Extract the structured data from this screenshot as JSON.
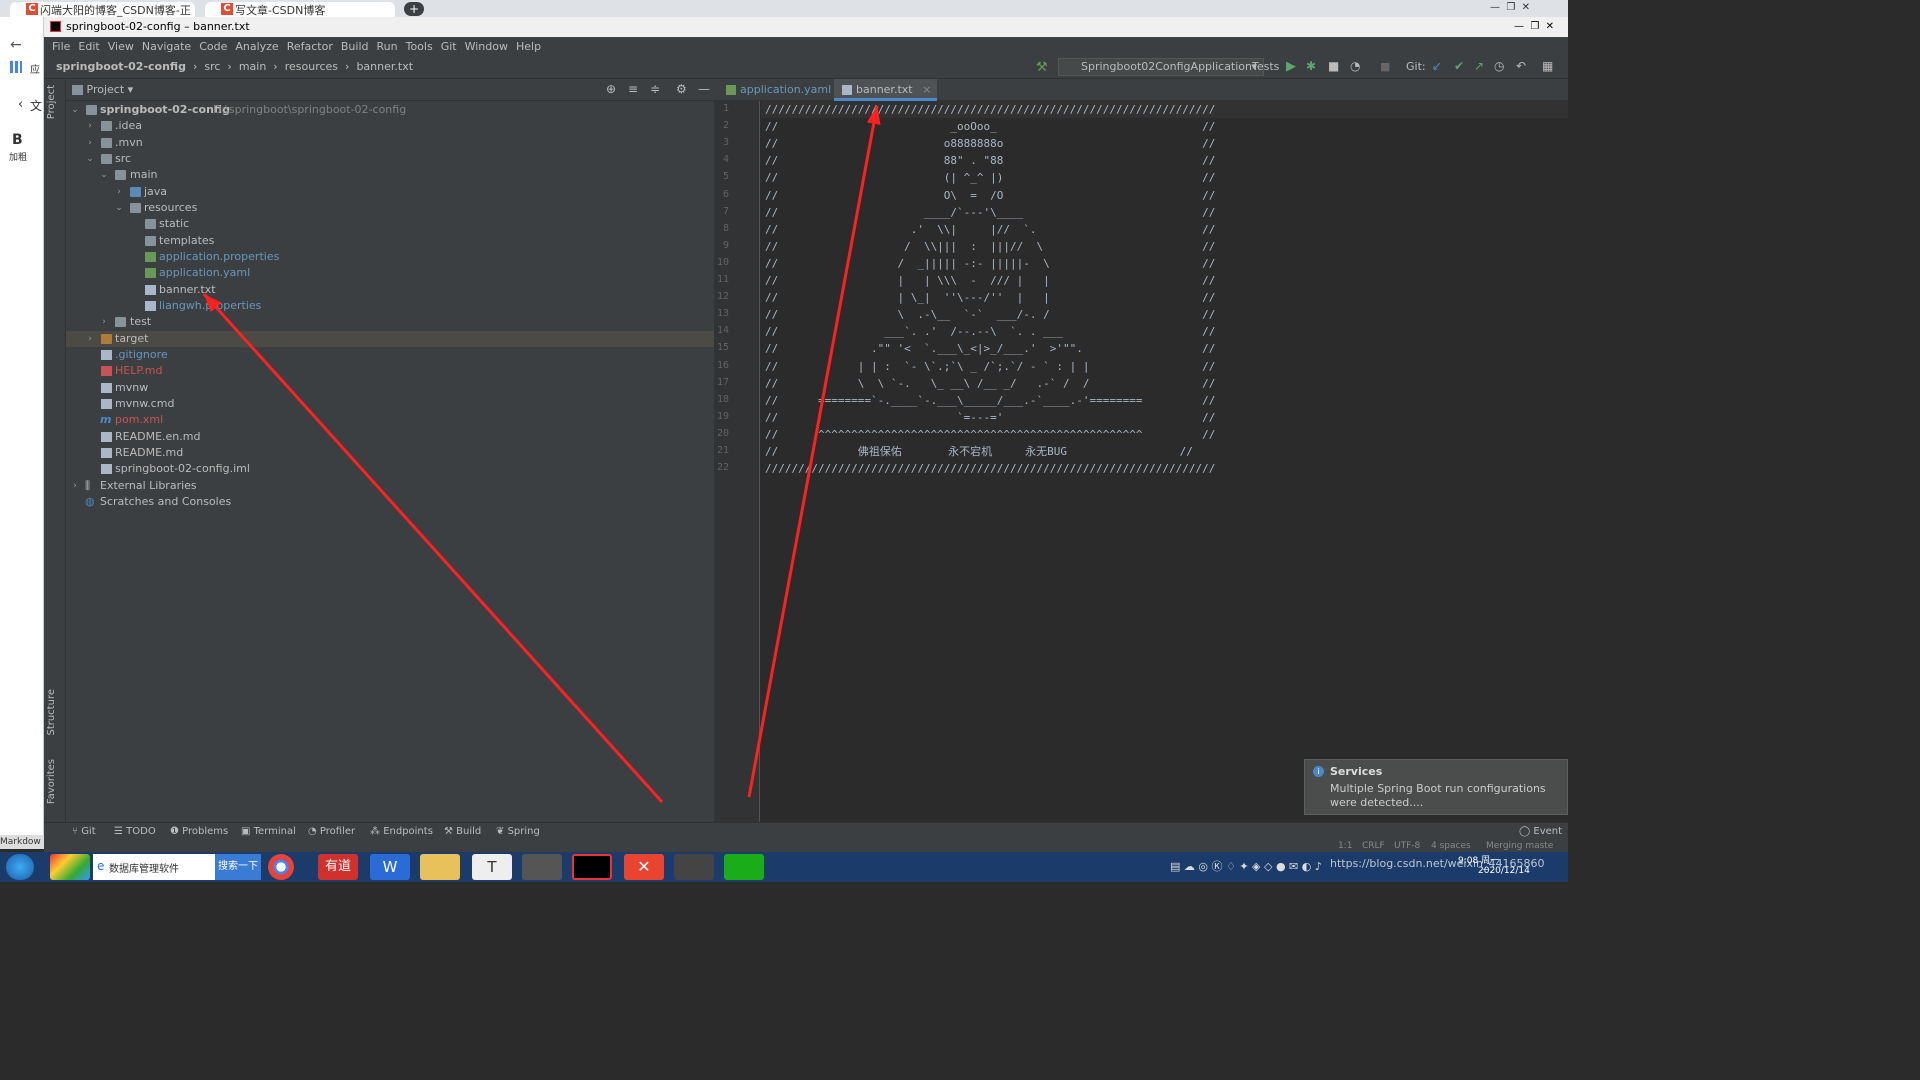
{
  "browser": {
    "tabs": [
      "闪端大阳的博客_CSDN博客-正",
      "写文章-CSDN博客"
    ],
    "left_labels": [
      "应",
      "文",
      "加粗",
      "Markdow"
    ]
  },
  "ide": {
    "window_title": "springboot-02-config – banner.txt",
    "menu": [
      "File",
      "Edit",
      "View",
      "Navigate",
      "Code",
      "Analyze",
      "Refactor",
      "Build",
      "Run",
      "Tools",
      "Git",
      "Window",
      "Help"
    ],
    "breadcrumbs": [
      "springboot-02-config",
      "src",
      "main",
      "resources",
      "banner.txt"
    ],
    "run_config": "Springboot02ConfigApplicationTests",
    "git_label": "Git:",
    "left_strip": [
      "Project",
      "Structure",
      "Favorites"
    ],
    "project_panel": {
      "title": "Project",
      "root_name": "springboot-02-config",
      "root_path": "D:\\springboot\\springboot-02-config",
      "tree": [
        {
          "label": ".idea"
        },
        {
          "label": ".mvn"
        },
        {
          "label": "src"
        },
        {
          "label": "main"
        },
        {
          "label": "java"
        },
        {
          "label": "resources"
        },
        {
          "label": "static"
        },
        {
          "label": "templates"
        },
        {
          "label": "application.properties"
        },
        {
          "label": "application.yaml"
        },
        {
          "label": "banner.txt"
        },
        {
          "label": "liangwh.properties"
        },
        {
          "label": "test"
        },
        {
          "label": "target"
        },
        {
          "label": ".gitignore"
        },
        {
          "label": "HELP.md"
        },
        {
          "label": "mvnw"
        },
        {
          "label": "mvnw.cmd"
        },
        {
          "label": "pom.xml"
        },
        {
          "label": "README.en.md"
        },
        {
          "label": "README.md"
        },
        {
          "label": "springboot-02-config.iml"
        },
        {
          "label": "External Libraries"
        },
        {
          "label": "Scratches and Consoles"
        }
      ]
    },
    "editor": {
      "tabs": [
        "application.yaml",
        "banner.txt"
      ],
      "active_tab": "banner.txt",
      "lines": [
        "////////////////////////////////////////////////////////////////////",
        "//                          _ooOoo_                               //",
        "//                         o8888888o                              //",
        "//                         88\" . \"88                              //",
        "//                         (| ^_^ |)                              //",
        "//                         O\\  =  /O                              //",
        "//                      ____/`---'\\____                           //",
        "//                    .'  \\\\|     |//  `.                         //",
        "//                   /  \\\\|||  :  |||//  \\                        //",
        "//                  /  _||||| -:- |||||-  \\                       //",
        "//                  |   | \\\\\\  -  /// |   |                       //",
        "//                  | \\_|  ''\\---/''  |   |                       //",
        "//                  \\  .-\\__  `-`  ___/-. /                       //",
        "//                ___`. .'  /--.--\\  `. . ___                     //",
        "//              .\"\" '<  `.___\\_<|>_/___.'  >'\"\".                  //",
        "//            | | :  `- \\`.;`\\ _ /`;.`/ - ` : | |                 //",
        "//            \\  \\ `-.   \\_ __\\ /__ _/   .-` /  /                 //",
        "//      ========`-.____`-.___\\_____/___.-`____.-'========         //",
        "//                           `=---='                              //",
        "//      ^^^^^^^^^^^^^^^^^^^^^^^^^^^^^^^^^^^^^^^^^^^^^^^^^         //",
        "//            佛祖保佑       永不宕机     永无BUG                 //",
        "////////////////////////////////////////////////////////////////////"
      ]
    },
    "bottom_tools": [
      "Git",
      "TODO",
      "Problems",
      "Terminal",
      "Profiler",
      "Endpoints",
      "Build",
      "Spring"
    ],
    "event_label": "Event",
    "notification": {
      "title": "Services",
      "body_line1": "Multiple Spring Boot run configurations",
      "body_line2": "were detected...."
    },
    "status": {
      "position": "1:1",
      "line_sep": "CRLF",
      "encoding": "UTF-8",
      "indent": "4 spaces",
      "git": "Merging maste"
    }
  },
  "taskbar": {
    "search_text": "数据库管理软件",
    "search_button": "搜索一下",
    "clock_time": "9:08 周一",
    "clock_date": "2020/12/14",
    "watermark": "https://blog.csdn.net/weixin_44165860"
  },
  "colors": {
    "annotation_arrow": "#ff2020",
    "accent": "#4a88c7"
  }
}
